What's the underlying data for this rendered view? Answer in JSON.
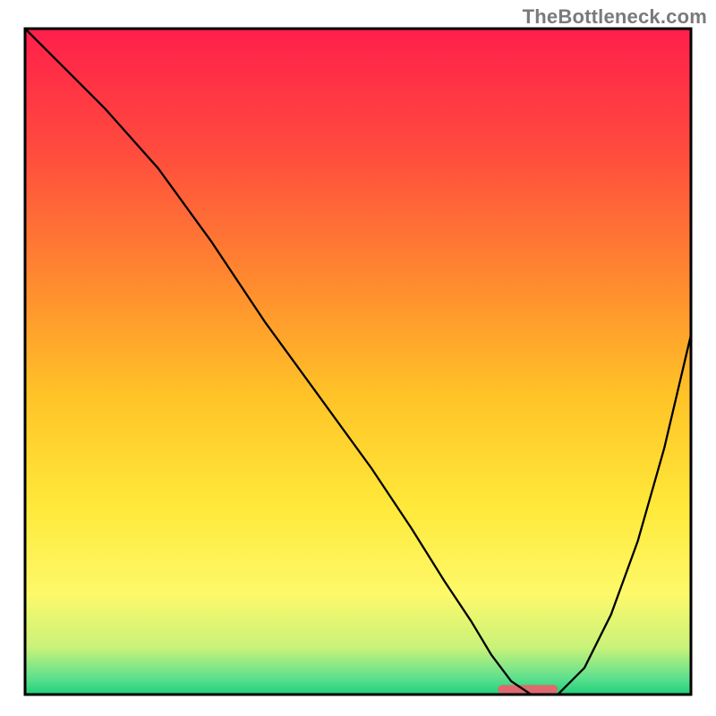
{
  "watermark": "TheBottleneck.com",
  "chart_data": {
    "type": "line",
    "title": "",
    "xlabel": "",
    "ylabel": "",
    "xlim": [
      0,
      100
    ],
    "ylim": [
      0,
      100
    ],
    "grid": false,
    "axes_visible": false,
    "legend": null,
    "background_gradient_stops": [
      {
        "offset": 0.0,
        "color": "#ff1f4b"
      },
      {
        "offset": 0.18,
        "color": "#ff4a3e"
      },
      {
        "offset": 0.38,
        "color": "#ff8a2f"
      },
      {
        "offset": 0.55,
        "color": "#ffc327"
      },
      {
        "offset": 0.72,
        "color": "#ffe93a"
      },
      {
        "offset": 0.85,
        "color": "#fdf96a"
      },
      {
        "offset": 0.93,
        "color": "#c8f27a"
      },
      {
        "offset": 0.975,
        "color": "#5ee08e"
      },
      {
        "offset": 1.0,
        "color": "#1fd07a"
      }
    ],
    "series": [
      {
        "name": "bottleneck-curve",
        "color": "#000000",
        "stroke_width": 2.3,
        "x": [
          0,
          6,
          12,
          20,
          28,
          36,
          44,
          52,
          58,
          63,
          67,
          70,
          73,
          76,
          80,
          84,
          88,
          92,
          96,
          100
        ],
        "values": [
          100,
          94,
          88,
          79,
          68,
          56,
          45,
          34,
          25,
          17,
          11,
          6,
          2,
          0,
          0,
          4,
          12,
          23,
          37,
          54
        ]
      }
    ],
    "annotations": [
      {
        "name": "optimal-range-marker",
        "shape": "rounded-rect",
        "color": "#dd6a6e",
        "x_start": 71,
        "x_end": 80,
        "y": 0,
        "height_pct": 1.3
      }
    ]
  }
}
